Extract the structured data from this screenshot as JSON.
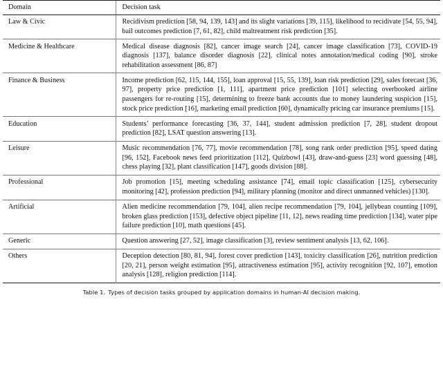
{
  "table": {
    "columns": [
      "Domain",
      "Decision task"
    ],
    "rows": [
      {
        "domain": "Law & Civic",
        "task": "Recidivism prediction [58, 94, 139, 143] and its slight variations [39, 115], likelihood to recidivate [54, 55, 94], bail outcomes prediction [7, 61, 82], child maltreatment risk prediction [35]."
      },
      {
        "domain": "Medicine & Healthcare",
        "task": "Medical disease diagnosis [82], cancer image search [24], cancer image classification [73], COVID-19 diagnosis [137], balance disorder diagnosis [22], clinical notes annotation/medical coding [90], stroke rehabilitation assessment [86, 87]"
      },
      {
        "domain": "Finance & Business",
        "task": "Income prediction [62, 115, 144, 155], loan approval [15, 55, 139], loan risk prediction [29], sales forecast [36, 97], property price prediction [1, 111], apartment price prediction [101] selecting overbooked airline passengers for re-routing [15], determining to freeze bank accounts due to money laundering suspicion [15], stock price prediction [16], marketing email prediction [60], dynamically pricing car insurance premiums [15]."
      },
      {
        "domain": "Education",
        "task": "Students’ performance forecasting [36, 37, 144], student admission prediction [7, 28], student dropout prediction [82], LSAT question answering [13]."
      },
      {
        "domain": "Leisure",
        "task": "Music recommendation [76, 77], movie recommendation [78], song rank order prediction [95], speed dating [96, 152], Facebook news feed prioritization [112], Quizbowl [43], draw-and-guess [23] word guessing [48], chess playing [32], plant classification [147], goods division [88]."
      },
      {
        "domain": "Professional",
        "task": "Job promotion [15], meeting scheduling assistance [74], email topic classification [125], cybersecurity monitoring [42], profession prediction [94], military planning (monitor and direct unmanned vehicles) [130]."
      },
      {
        "domain": "Artificial",
        "task": "Alien medicine recommendation [79, 104], alien recipe recommendation [79, 104], jellybean counting [109], broken glass prediction [153], defective object pipeline [11, 12], news reading time prediction [134], water pipe failure prediction [10], math questions [45]."
      },
      {
        "domain": "Generic",
        "task": "Question answering [27, 52], image classification [3], review sentiment analysis [13, 62, 106]."
      },
      {
        "domain": "Others",
        "task": "Deception detection [80, 81, 94], forest cover prediction [143], toxicity classification [26], nutrition prediction [20, 21], person weight estimation [95], attractiveness estimation [95], activity recognition [92, 107], emotion analysis [128], religion prediction [114]."
      }
    ]
  },
  "caption": {
    "number": "Table 1.",
    "text": "Types of decision tasks grouped by application domains in human-AI decision making."
  }
}
